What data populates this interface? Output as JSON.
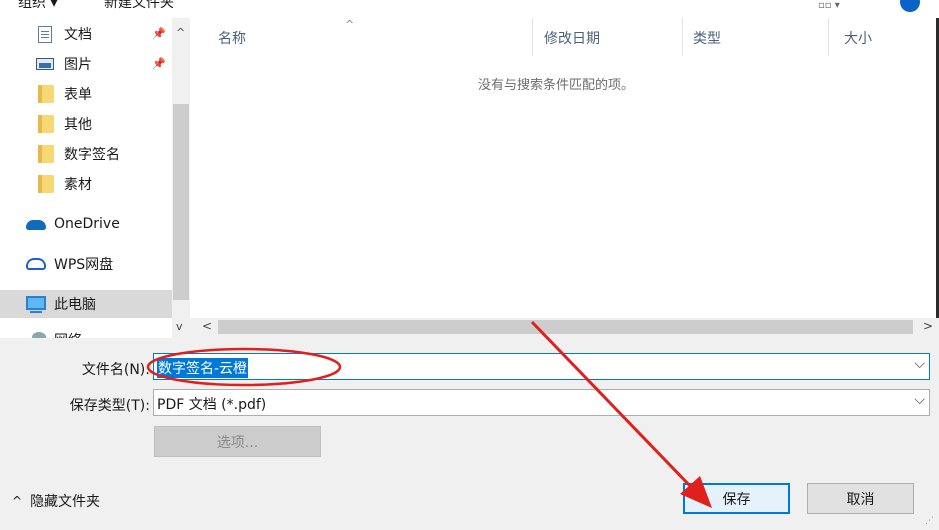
{
  "toolbar": {
    "organize_label": "组织 ▾",
    "new_folder_label": "新建文件夹",
    "view_label": "▫▫ ▾"
  },
  "nav": {
    "items": [
      {
        "label": "文档",
        "pinned": true
      },
      {
        "label": "图片",
        "pinned": true
      },
      {
        "label": "表单"
      },
      {
        "label": "其他"
      },
      {
        "label": "数字签名"
      },
      {
        "label": "素材"
      },
      {
        "label": "OneDrive"
      },
      {
        "label": "WPS网盘"
      },
      {
        "label": "此电脑",
        "selected": true
      },
      {
        "label": "网络"
      }
    ],
    "pin_glyph": "📌"
  },
  "filelist": {
    "columns": [
      "名称",
      "修改日期",
      "类型",
      "大小"
    ],
    "empty_message": "没有与搜索条件匹配的项。"
  },
  "form": {
    "filename_label": "文件名(N):",
    "filename_value": "数字签名-云橙",
    "filetype_label": "保存类型(T):",
    "filetype_value": "PDF 文档 (*.pdf)",
    "options_label": "选项..."
  },
  "footer": {
    "hide_folders_label": "隐藏文件夹",
    "save_label": "保存",
    "cancel_label": "取消"
  },
  "colors": {
    "accent": "#0078d7",
    "annotation": "#e0201c"
  }
}
